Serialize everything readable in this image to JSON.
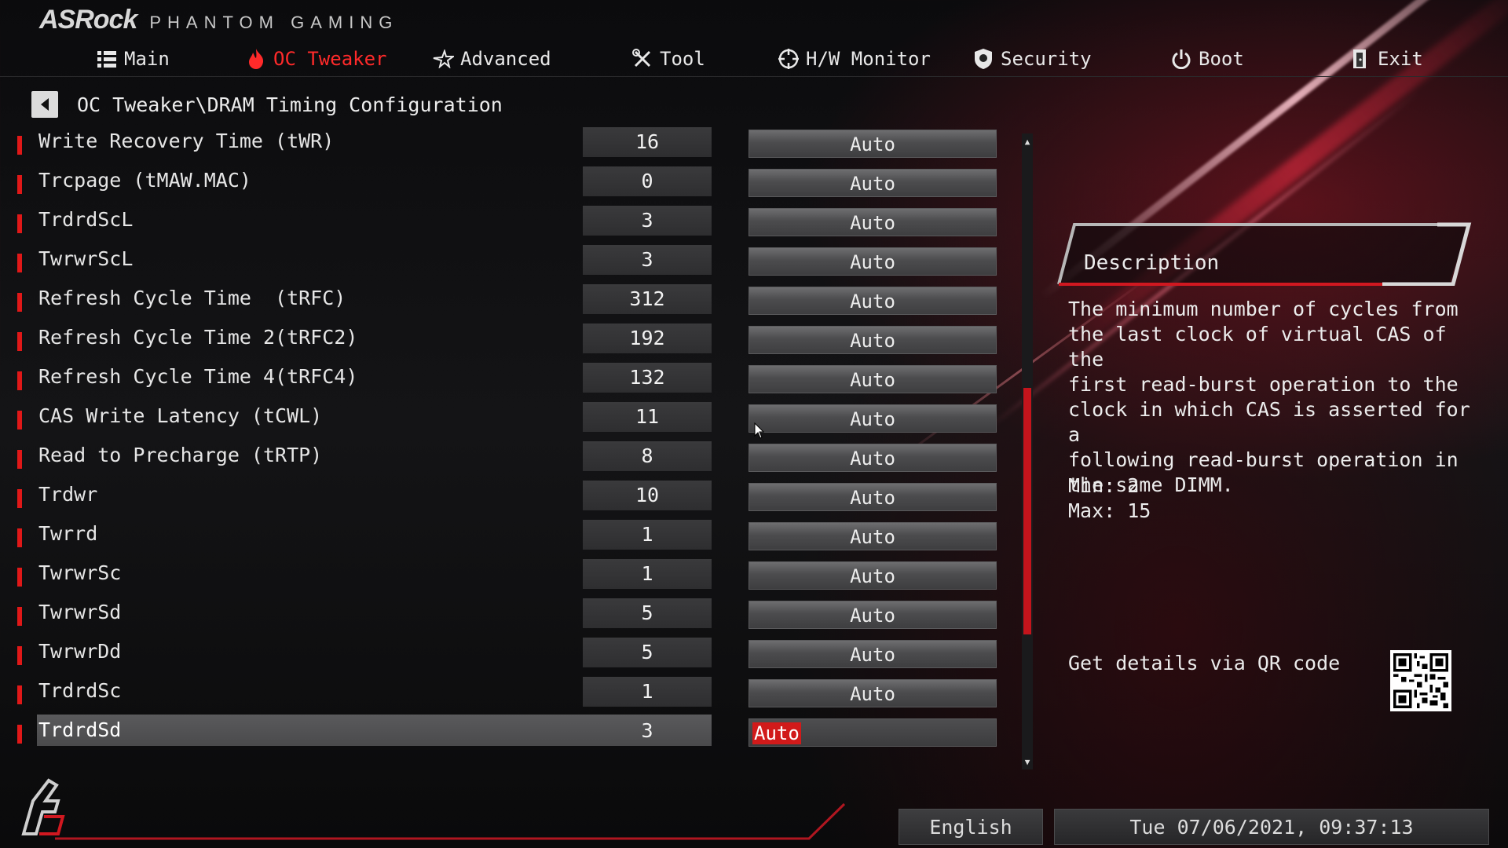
{
  "brand": {
    "name": "ASRock",
    "subtitle": "PHANTOM GAMING"
  },
  "nav": [
    {
      "label": "Main",
      "icon": "list-icon",
      "active": false
    },
    {
      "label": "OC Tweaker",
      "icon": "flame-icon",
      "active": true
    },
    {
      "label": "Advanced",
      "icon": "star-icon",
      "active": false
    },
    {
      "label": "Tool",
      "icon": "tools-icon",
      "active": false
    },
    {
      "label": "H/W Monitor",
      "icon": "crosshair-icon",
      "active": false
    },
    {
      "label": "Security",
      "icon": "shield-icon",
      "active": false
    },
    {
      "label": "Boot",
      "icon": "power-icon",
      "active": false
    },
    {
      "label": "Exit",
      "icon": "exit-icon",
      "active": false
    }
  ],
  "breadcrumb": {
    "path": "OC Tweaker\\DRAM Timing Configuration"
  },
  "settings": [
    {
      "label": "Write Recovery Time (tWR)",
      "value": "16",
      "option": "Auto"
    },
    {
      "label": "Trcpage (tMAW.MAC)",
      "value": "0",
      "option": "Auto"
    },
    {
      "label": "TrdrdScL",
      "value": "3",
      "option": "Auto"
    },
    {
      "label": "TwrwrScL",
      "value": "3",
      "option": "Auto"
    },
    {
      "label": "Refresh Cycle Time  (tRFC)",
      "value": "312",
      "option": "Auto"
    },
    {
      "label": "Refresh Cycle Time 2(tRFC2)",
      "value": "192",
      "option": "Auto"
    },
    {
      "label": "Refresh Cycle Time 4(tRFC4)",
      "value": "132",
      "option": "Auto"
    },
    {
      "label": "CAS Write Latency (tCWL)",
      "value": "11",
      "option": "Auto"
    },
    {
      "label": "Read to Precharge (tRTP)",
      "value": "8",
      "option": "Auto"
    },
    {
      "label": "Trdwr",
      "value": "10",
      "option": "Auto"
    },
    {
      "label": "Twrrd",
      "value": "1",
      "option": "Auto"
    },
    {
      "label": "TwrwrSc",
      "value": "1",
      "option": "Auto"
    },
    {
      "label": "TwrwrSd",
      "value": "5",
      "option": "Auto"
    },
    {
      "label": "TwrwrDd",
      "value": "5",
      "option": "Auto"
    },
    {
      "label": "TrdrdSc",
      "value": "1",
      "option": "Auto"
    },
    {
      "label": "TrdrdSd",
      "value": "3",
      "option": "Auto",
      "selected": true
    }
  ],
  "description": {
    "title": "Description",
    "body": "The minimum number of cycles from\nthe last clock of virtual CAS of the\nfirst read-burst operation to the\nclock in which CAS is asserted for a\nfollowing read-burst operation in\nthe same DIMM.",
    "min": "Min: 2",
    "max": "Max: 15",
    "qr_text": "Get details via QR code"
  },
  "footer": {
    "language": "English",
    "datetime": "Tue 07/06/2021, 09:37:13"
  },
  "colors": {
    "accent": "#e01818",
    "active_tab": "#ff2a2a",
    "background": "#101012"
  }
}
